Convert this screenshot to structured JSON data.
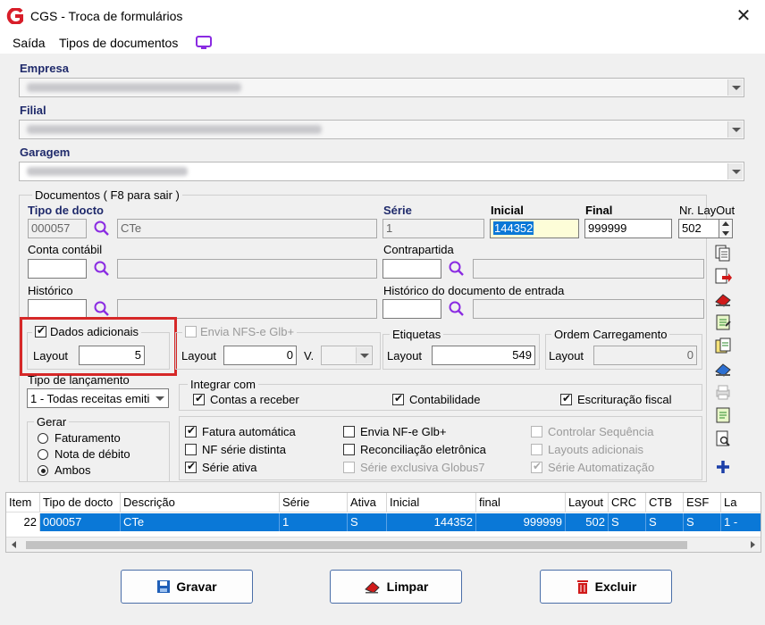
{
  "window": {
    "title": "CGS - Troca de formulários"
  },
  "menu": {
    "items": [
      "Saída",
      "Tipos de documentos"
    ]
  },
  "empresa": {
    "label": "Empresa"
  },
  "filial": {
    "label": "Filial"
  },
  "garagem": {
    "label": "Garagem"
  },
  "documentos": {
    "group_title": "Documentos ( F8 para sair )",
    "tipo_docto_label": "Tipo de docto",
    "tipo_docto_code": "000057",
    "tipo_docto_desc": "CTe",
    "serie_label": "Série",
    "serie_value": "1",
    "inicial_label": "Inicial",
    "inicial_value": "144352",
    "final_label": "Final",
    "final_value": "999999",
    "nr_layout_label": "Nr. LayOut",
    "nr_layout_value": "502",
    "conta_contabil_label": "Conta contábil",
    "contrapartida_label": "Contrapartida",
    "historico_label": "Histórico",
    "historico_entrada_label": "Histórico do documento de entrada"
  },
  "dados_adicionais": {
    "label": "Dados adicionais",
    "checked": true,
    "layout_label": "Layout",
    "layout_value": "5"
  },
  "envia_nfs": {
    "label": "Envia NFS-e Glb+",
    "checked": false,
    "layout_label": "Layout",
    "layout_value": "0",
    "v_label": "V."
  },
  "etiquetas": {
    "title": "Etiquetas",
    "layout_label": "Layout",
    "layout_value": "549"
  },
  "ordem_carregamento": {
    "title": "Ordem Carregamento",
    "layout_label": "Layout",
    "layout_value": "0"
  },
  "tipo_lancamento": {
    "label": "Tipo de lançamento",
    "value": "1 - Todas receitas emiti"
  },
  "integrar_com": {
    "title": "Integrar com",
    "items": [
      {
        "label": "Contas a receber",
        "checked": true
      },
      {
        "label": "Contabilidade",
        "checked": true
      },
      {
        "label": "Escrituração fiscal",
        "checked": true
      }
    ]
  },
  "gerar": {
    "title": "Gerar",
    "options": [
      {
        "label": "Faturamento",
        "selected": false
      },
      {
        "label": "Nota de débito",
        "selected": false
      },
      {
        "label": "Ambos",
        "selected": true
      }
    ]
  },
  "options": {
    "col1": [
      {
        "label": "Fatura automática",
        "checked": true,
        "disabled": false
      },
      {
        "label": "NF série distinta",
        "checked": false,
        "disabled": false
      },
      {
        "label": "Série ativa",
        "checked": true,
        "disabled": false
      }
    ],
    "col2": [
      {
        "label": "Envia NF-e Glb+",
        "checked": false,
        "disabled": false
      },
      {
        "label": "Reconciliação eletrônica",
        "checked": false,
        "disabled": false
      },
      {
        "label": "Série exclusiva Globus7",
        "checked": false,
        "disabled": true
      }
    ],
    "col3": [
      {
        "label": "Controlar Sequência",
        "checked": false,
        "disabled": true
      },
      {
        "label": "Layouts adicionais",
        "checked": false,
        "disabled": true
      },
      {
        "label": "Série Automatização",
        "checked": true,
        "disabled": true
      }
    ]
  },
  "grid": {
    "columns": [
      "Item",
      "Tipo de docto",
      "Descrição",
      "Série",
      "Ativa",
      "Inicial",
      "final",
      "Layout",
      "CRC",
      "CTB",
      "ESF",
      "La"
    ],
    "rows": [
      [
        "22",
        "000057",
        "CTe",
        "1",
        "S",
        "144352",
        "999999",
        "502",
        "S",
        "S",
        "S",
        "1 -"
      ]
    ]
  },
  "buttons": {
    "gravar": "Gravar",
    "limpar": "Limpar",
    "excluir": "Excluir"
  },
  "colors": {
    "accent": "#0a78d7",
    "highlight_box": "#d62828",
    "label_blue": "#1f2a6b",
    "purple_icon": "#8a2be2"
  }
}
